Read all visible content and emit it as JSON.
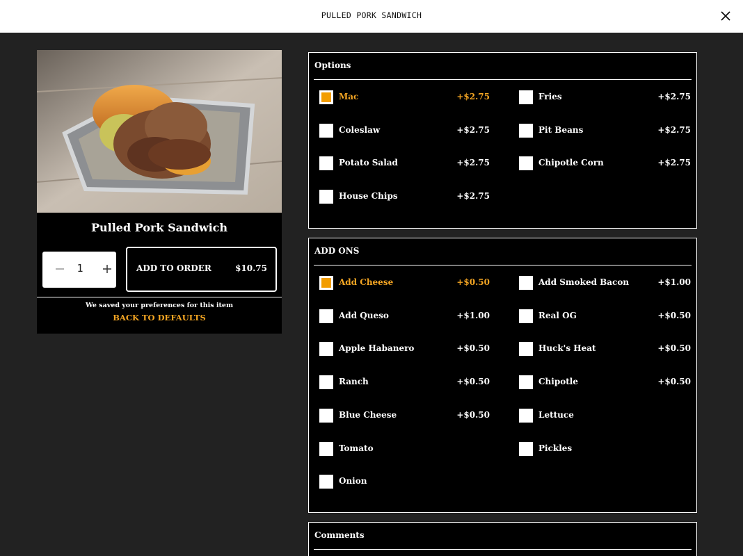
{
  "header": {
    "title": "PULLED PORK SANDWICH"
  },
  "item": {
    "name": "Pulled Pork Sandwich",
    "quantity": "1",
    "add_label": "ADD TO ORDER",
    "add_price": "$10.75",
    "saved_note": "We saved your preferences for this item",
    "back_defaults": "BACK TO DEFAULTS"
  },
  "options": {
    "title": "Options",
    "items": [
      {
        "label": "Mac",
        "price": "+$2.75",
        "checked": true
      },
      {
        "label": "Fries",
        "price": "+$2.75",
        "checked": false
      },
      {
        "label": "Coleslaw",
        "price": "+$2.75",
        "checked": false
      },
      {
        "label": "Pit Beans",
        "price": "+$2.75",
        "checked": false
      },
      {
        "label": "Potato Salad",
        "price": "+$2.75",
        "checked": false
      },
      {
        "label": "Chipotle Corn",
        "price": "+$2.75",
        "checked": false
      },
      {
        "label": "House Chips",
        "price": "+$2.75",
        "checked": false
      }
    ]
  },
  "addons": {
    "title": "ADD ONS",
    "items": [
      {
        "label": "Add Cheese",
        "price": "+$0.50",
        "checked": true
      },
      {
        "label": "Add Smoked Bacon",
        "price": "+$1.00",
        "checked": false
      },
      {
        "label": "Add Queso",
        "price": "+$1.00",
        "checked": false
      },
      {
        "label": "Real OG",
        "price": "+$0.50",
        "checked": false
      },
      {
        "label": "Apple Habanero",
        "price": "+$0.50",
        "checked": false
      },
      {
        "label": "Huck's Heat",
        "price": "+$0.50",
        "checked": false
      },
      {
        "label": "Ranch",
        "price": "+$0.50",
        "checked": false
      },
      {
        "label": "Chipotle",
        "price": "+$0.50",
        "checked": false
      },
      {
        "label": "Blue Cheese",
        "price": "+$0.50",
        "checked": false
      },
      {
        "label": "Lettuce",
        "price": "",
        "checked": false
      },
      {
        "label": "Tomato",
        "price": "",
        "checked": false
      },
      {
        "label": "Pickles",
        "price": "",
        "checked": false
      },
      {
        "label": "Onion",
        "price": "",
        "checked": false
      }
    ]
  },
  "comments": {
    "title": "Comments"
  },
  "colors": {
    "accent": "#f5a623",
    "background": "#222222",
    "panel": "#000000"
  }
}
